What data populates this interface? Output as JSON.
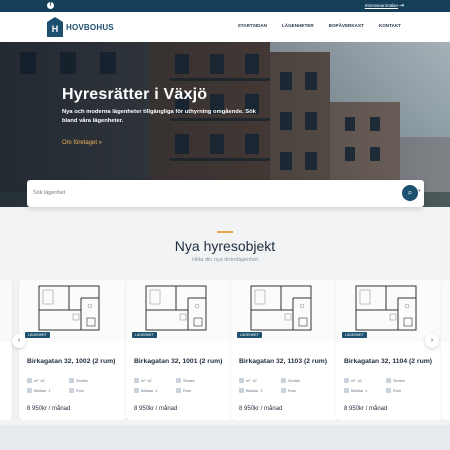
{
  "topbar": {
    "facebook_icon": "facebook-icon",
    "login_label": "Intresseanmälan",
    "login_icon": "login-icon"
  },
  "header": {
    "logo_text": "HOVBOHUS",
    "logo_letter": "H",
    "nav": [
      "STARTSIDAN",
      "LÄGENHETER",
      "BOPÅVERKAST",
      "KONTAKT"
    ]
  },
  "hero": {
    "title": "Hyresrätter i Växjö",
    "subtitle": "Nya och moderna lägenheter tillgängliga för uthyrning omgående. Sök bland våra lägenheter.",
    "link": "Om företaget »"
  },
  "search": {
    "placeholder": "Sök lägenhet",
    "chevron_icon": "chevron-down-icon",
    "button_icon": "search-icon"
  },
  "section": {
    "title": "Nya hyresobjekt",
    "subtitle": "Hitta din nya drömlägenhet"
  },
  "carousel": {
    "prev_icon": "chevron-left-icon",
    "next_icon": "chevron-right-icon",
    "cards": [
      {
        "tag": "LÄGENHET",
        "title": "Birkagatan 32, 1002 (2 rum)",
        "area": "42",
        "area_label": "Storlek",
        "rooms_label": "Rum",
        "beds": "1",
        "beds_label": "Bäddar",
        "price": "8 950kr / månad"
      },
      {
        "tag": "LÄGENHET",
        "title": "Birkagatan 32, 1001 (2 rum)",
        "area": "42",
        "area_label": "Storlek",
        "rooms_label": "Rum",
        "beds": "1",
        "beds_label": "Bäddar",
        "price": "8 950kr / månad"
      },
      {
        "tag": "LÄGENHET",
        "title": "Birkagatan 32, 1103 (2 rum)",
        "area": "42",
        "area_label": "Storlek",
        "rooms_label": "Rum",
        "beds": "1",
        "beds_label": "Bäddar",
        "price": "8 950kr / månad"
      },
      {
        "tag": "LÄGENHET",
        "title": "Birkagatan 32, 1104 (2 rum)",
        "area": "42",
        "area_label": "Storlek",
        "rooms_label": "Rum",
        "beds": "1",
        "beds_label": "Bäddar",
        "price": "8 950kr / månad"
      }
    ]
  },
  "colors": {
    "brand": "#1d4f6f",
    "topbar": "#163f5a",
    "accent": "#f0a24a"
  }
}
